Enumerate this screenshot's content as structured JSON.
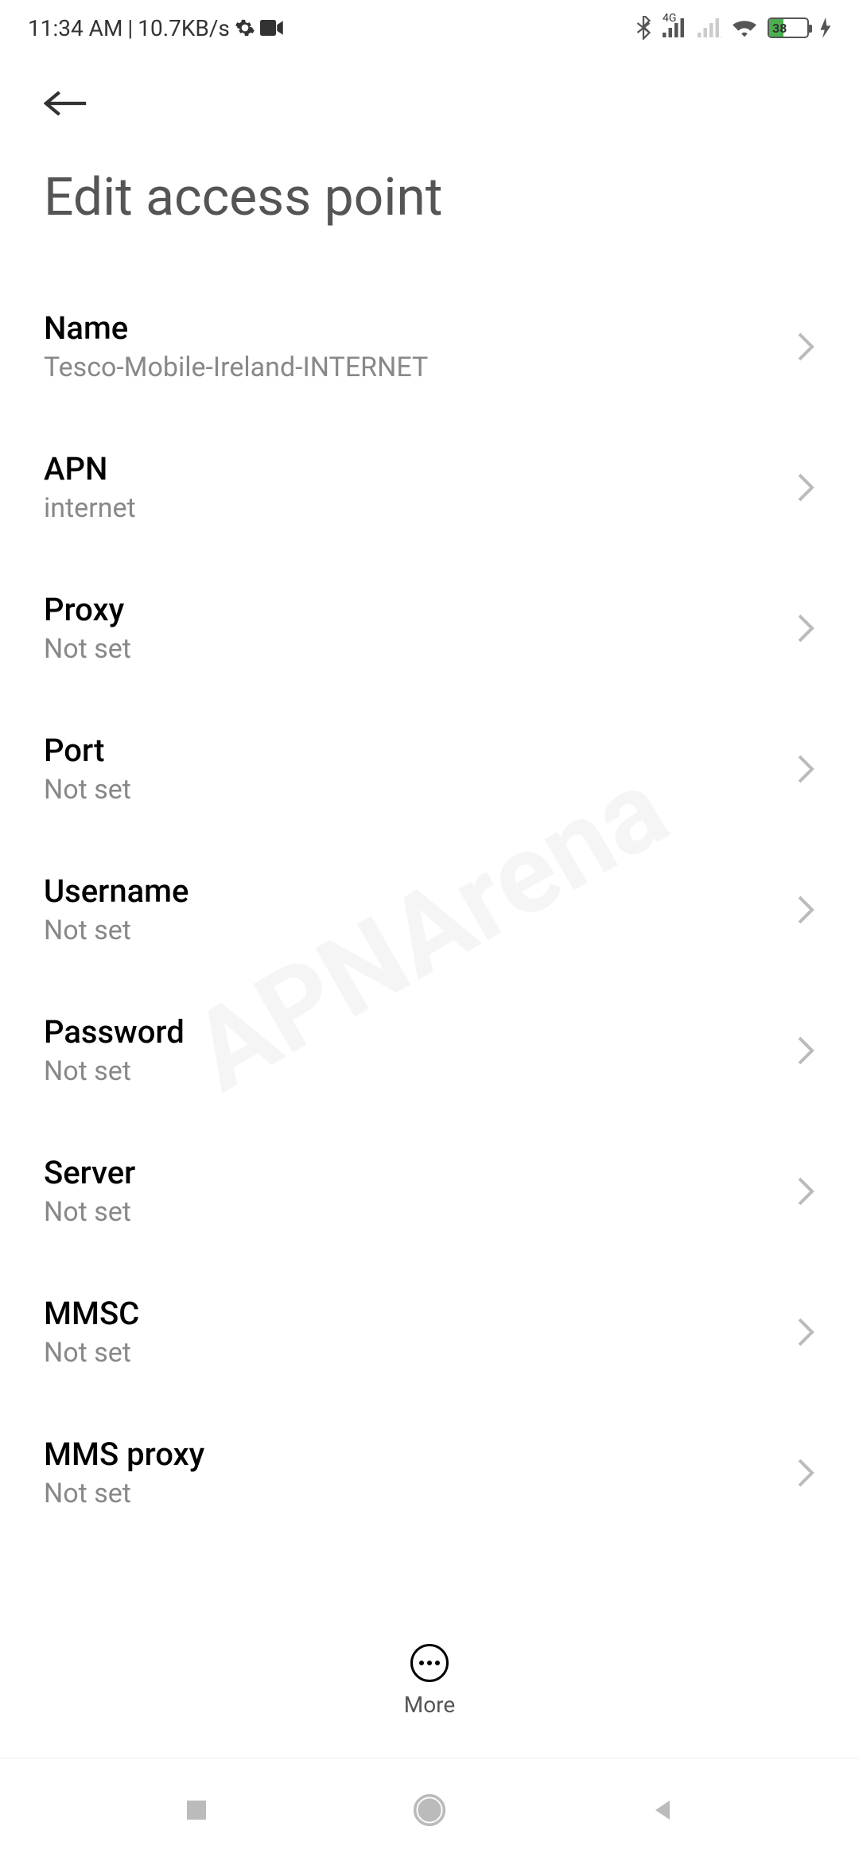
{
  "status": {
    "time": "11:34 AM",
    "separator": "|",
    "data_rate": "10.7KB/s",
    "network_type": "4G",
    "battery_percent": "38"
  },
  "page": {
    "title": "Edit access point"
  },
  "settings": [
    {
      "label": "Name",
      "value": "Tesco-Mobile-Ireland-INTERNET"
    },
    {
      "label": "APN",
      "value": "internet"
    },
    {
      "label": "Proxy",
      "value": "Not set"
    },
    {
      "label": "Port",
      "value": "Not set"
    },
    {
      "label": "Username",
      "value": "Not set"
    },
    {
      "label": "Password",
      "value": "Not set"
    },
    {
      "label": "Server",
      "value": "Not set"
    },
    {
      "label": "MMSC",
      "value": "Not set"
    },
    {
      "label": "MMS proxy",
      "value": "Not set"
    }
  ],
  "actions": {
    "more_label": "More"
  },
  "watermark": "APNArena"
}
